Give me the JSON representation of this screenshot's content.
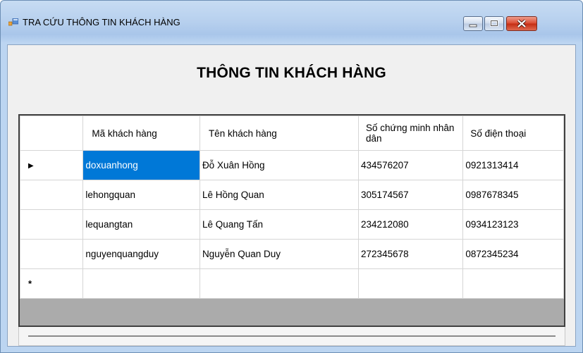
{
  "window": {
    "title": "TRA CỨU THÔNG TIN KHÁCH HÀNG"
  },
  "heading": "THÔNG TIN KHÁCH HÀNG",
  "grid": {
    "columns": [
      "Mã khách hàng",
      "Tên khách hàng",
      "Số chứng minh nhân dân",
      "Số điện thoại"
    ],
    "current_row_marker": "▶",
    "new_row_marker": "*",
    "rows": [
      {
        "ma": "doxuanhong",
        "ten": "Đỗ Xuân Hồng",
        "cmnd": "434576207",
        "sdt": "0921313414"
      },
      {
        "ma": "lehongquan",
        "ten": "Lê Hồng Quan",
        "cmnd": "305174567",
        "sdt": "0987678345"
      },
      {
        "ma": "lequangtan",
        "ten": "Lê Quang Tấn",
        "cmnd": "234212080",
        "sdt": "0934123123"
      },
      {
        "ma": "nguyenquangduy",
        "ten": "Nguyễn Quan Duy",
        "cmnd": "272345678",
        "sdt": "0872345234"
      }
    ]
  }
}
